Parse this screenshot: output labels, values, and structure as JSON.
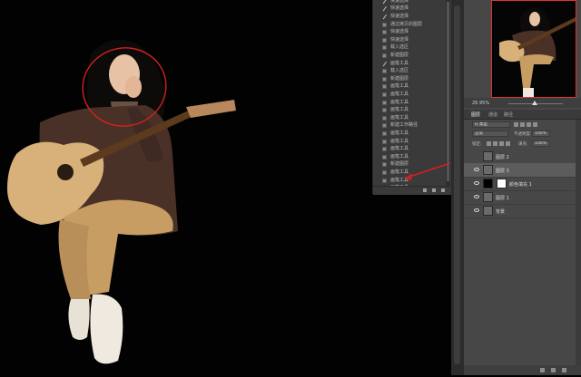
{
  "history": {
    "items": [
      {
        "label": "快速选择",
        "icon": "brush-icon"
      },
      {
        "label": "快速选择",
        "icon": "brush-icon"
      },
      {
        "label": "快速选择",
        "icon": "brush-icon"
      },
      {
        "label": "通过拷贝的图层",
        "icon": "step-icon"
      },
      {
        "label": "快速选择",
        "icon": "step-icon"
      },
      {
        "label": "快速选择",
        "icon": "step-icon"
      },
      {
        "label": "载入选区",
        "icon": "step-icon"
      },
      {
        "label": "新建图层",
        "icon": "step-icon"
      },
      {
        "label": "画笔工具",
        "icon": "brush-icon"
      },
      {
        "label": "载入选区",
        "icon": "step-icon"
      },
      {
        "label": "新建图层",
        "icon": "step-icon"
      },
      {
        "label": "画笔工具",
        "icon": "step-icon"
      },
      {
        "label": "画笔工具",
        "icon": "step-icon"
      },
      {
        "label": "画笔工具",
        "icon": "step-icon"
      },
      {
        "label": "画笔工具",
        "icon": "step-icon"
      },
      {
        "label": "画笔工具",
        "icon": "step-icon"
      },
      {
        "label": "新建工作路径",
        "icon": "step-icon"
      },
      {
        "label": "画笔工具",
        "icon": "step-icon"
      },
      {
        "label": "画笔工具",
        "icon": "step-icon"
      },
      {
        "label": "画笔工具",
        "icon": "step-icon"
      },
      {
        "label": "画笔工具",
        "icon": "step-icon"
      },
      {
        "label": "新建图层",
        "icon": "step-icon"
      },
      {
        "label": "画笔工具",
        "icon": "step-icon"
      },
      {
        "label": "画笔工具",
        "icon": "step-icon"
      },
      {
        "label": "画笔工具",
        "icon": "step-icon"
      },
      {
        "label": "通过拷贝的图层",
        "icon": "step-icon"
      },
      {
        "label": "画笔工具",
        "icon": "step-icon"
      },
      {
        "label": "通过拷贝的图层",
        "icon": "step-icon"
      },
      {
        "label": "图层样式",
        "icon": "step-icon"
      },
      {
        "label": "背景",
        "icon": "crop-icon"
      }
    ]
  },
  "navigator": {
    "zoom": "26.95%"
  },
  "layers_panel": {
    "tabs": [
      "图层",
      "通道",
      "路径"
    ],
    "kind_filter": "Q 类型",
    "blend_mode": "正常",
    "opacity_label": "不透明度:",
    "opacity_value": "100%",
    "lock_label": "锁定:",
    "fill_label": "填充:",
    "fill_value": "100%",
    "layers": [
      {
        "name": "图层 2",
        "selected": false,
        "visible": false
      },
      {
        "name": "图层 3",
        "selected": true,
        "visible": true
      },
      {
        "name": "颜色填充 1",
        "selected": false,
        "visible": true
      },
      {
        "name": "图层 1",
        "selected": false,
        "visible": true
      },
      {
        "name": "背景",
        "selected": false,
        "visible": true
      }
    ]
  },
  "colors": {
    "annotation_red": "#d42020",
    "panel": "#474747",
    "canvas": "#020202"
  }
}
